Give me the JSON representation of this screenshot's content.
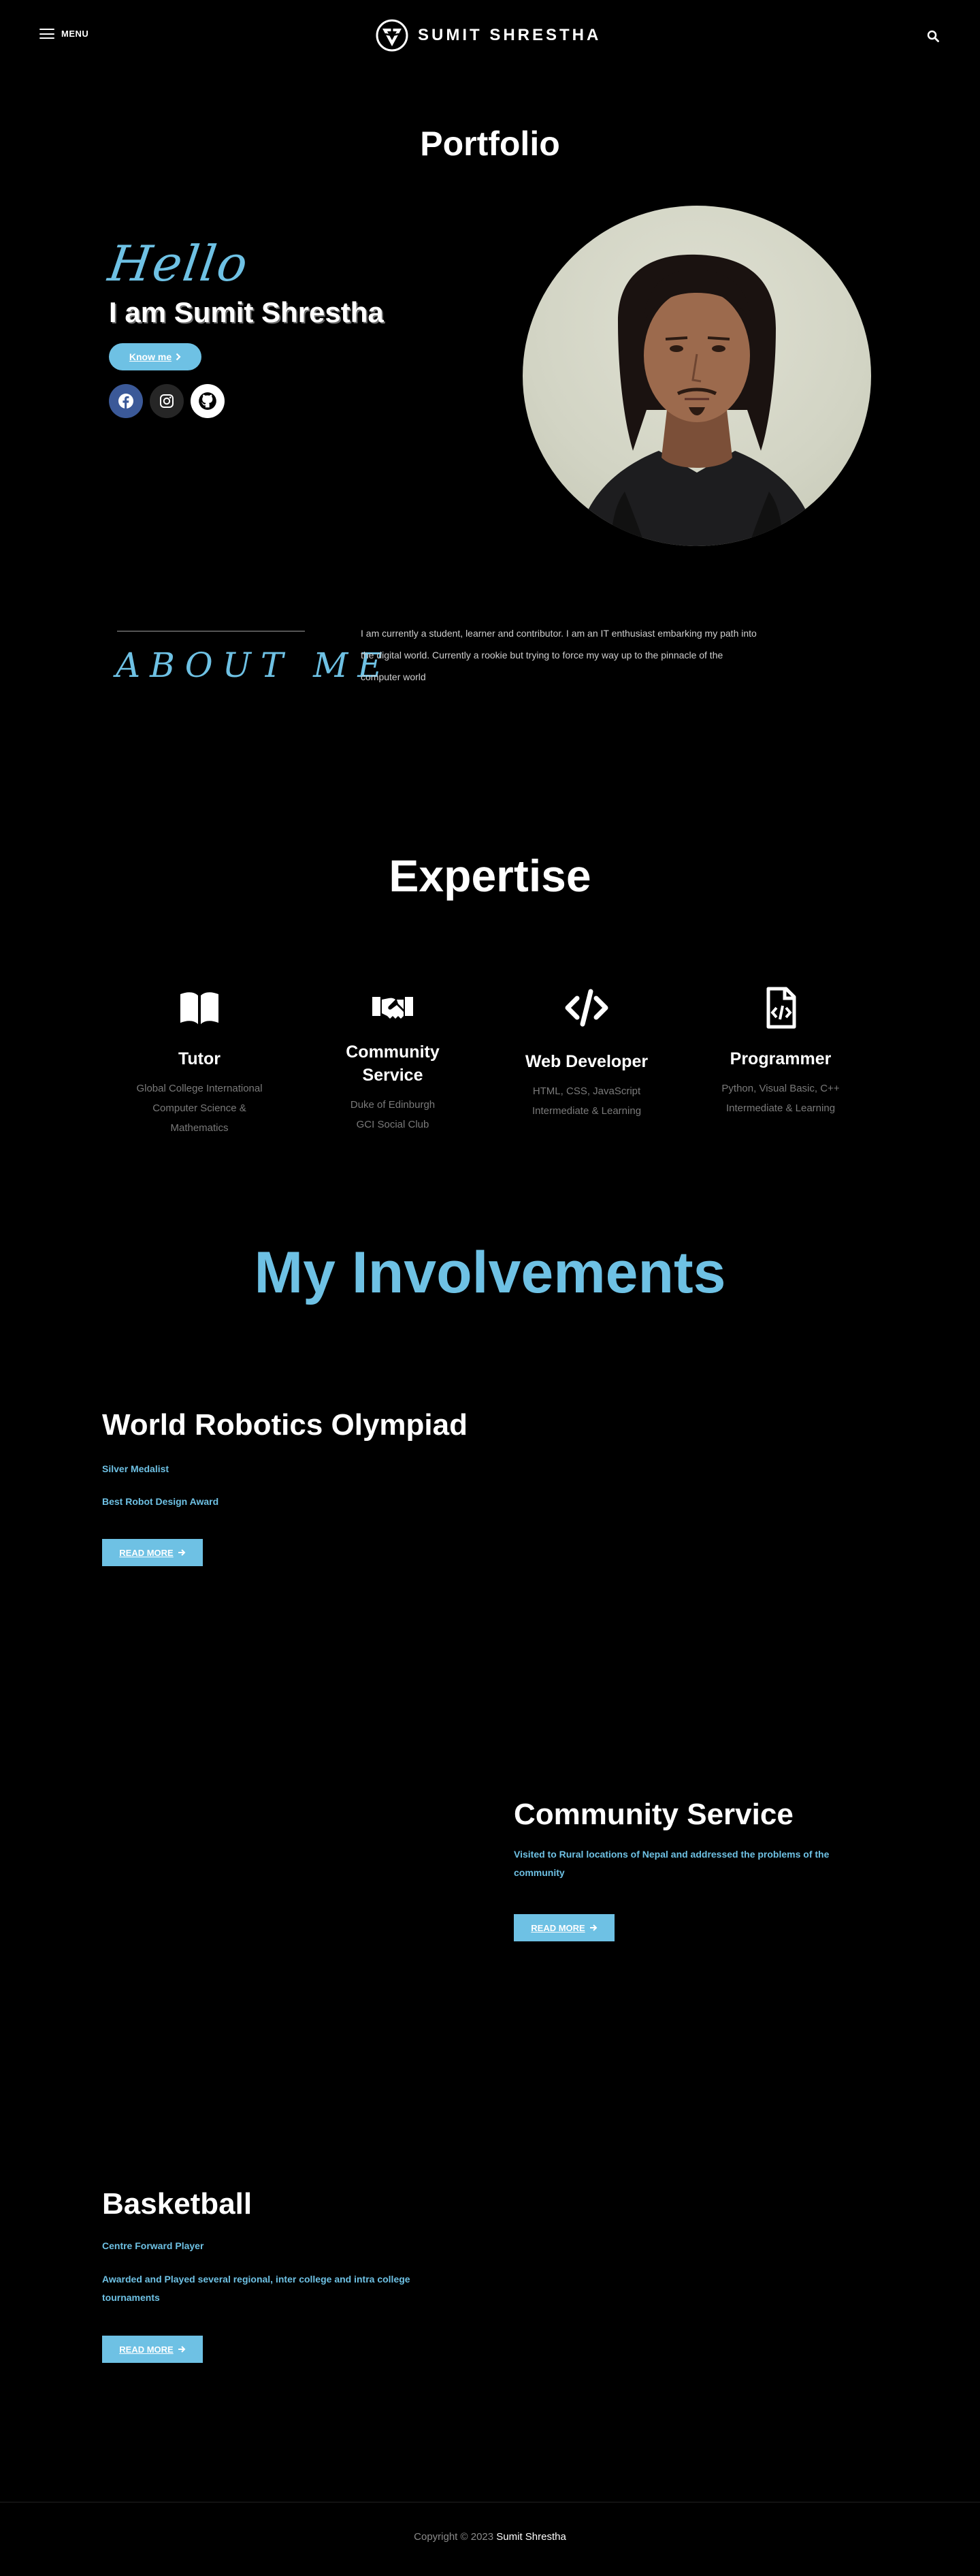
{
  "header": {
    "menu_label": "MENU",
    "brand_name": "SUMIT SHRESTHA"
  },
  "hero": {
    "page_title": "Portfolio",
    "hello": "Hello",
    "intro": "I am Sumit Shrestha",
    "know_button": "Know me"
  },
  "about": {
    "title": "ABOUT ME",
    "text": "I am currently a student, learner and contributor. I am an IT enthusiast embarking my path into the digital world. Currently a rookie but trying to force my way up to the pinnacle of the computer world"
  },
  "expertise": {
    "title": "Expertise",
    "items": [
      {
        "title": "Tutor",
        "desc": [
          "Global College International",
          "Computer Science &",
          "Mathematics"
        ],
        "icon": "book-icon"
      },
      {
        "title_lines": [
          "Community",
          "Service"
        ],
        "desc": [
          "Duke of Edinburgh",
          "GCI Social Club"
        ],
        "icon": "handshake-icon"
      },
      {
        "title": "Web Developer",
        "desc": [
          "HTML, CSS, JavaScript",
          "Intermediate & Learning"
        ],
        "icon": "code-icon"
      },
      {
        "title": "Programmer",
        "desc": [
          "Python, Visual Basic, C++",
          "Intermediate & Learning"
        ],
        "icon": "file-code-icon"
      }
    ]
  },
  "involvements": {
    "title": "My Involvements",
    "read_more": "READ MORE",
    "robotics": {
      "title": "World Robotics Olympiad",
      "line1": "Silver Medalist",
      "line2": "Best Robot Design Award"
    },
    "community": {
      "title": "Community Service",
      "line1": "Visited to Rural locations of Nepal and addressed the problems of the community"
    },
    "basketball": {
      "title": "Basketball",
      "line1": "Centre Forward Player",
      "line2": "Awarded and Played several regional, inter college and intra college tournaments"
    }
  },
  "footer": {
    "copyright": "Copyright © 2023",
    "name": "Sumit Shrestha"
  },
  "colors": {
    "accent": "#6ec1e4",
    "background": "#000000",
    "muted_text": "#7a7a7a"
  }
}
